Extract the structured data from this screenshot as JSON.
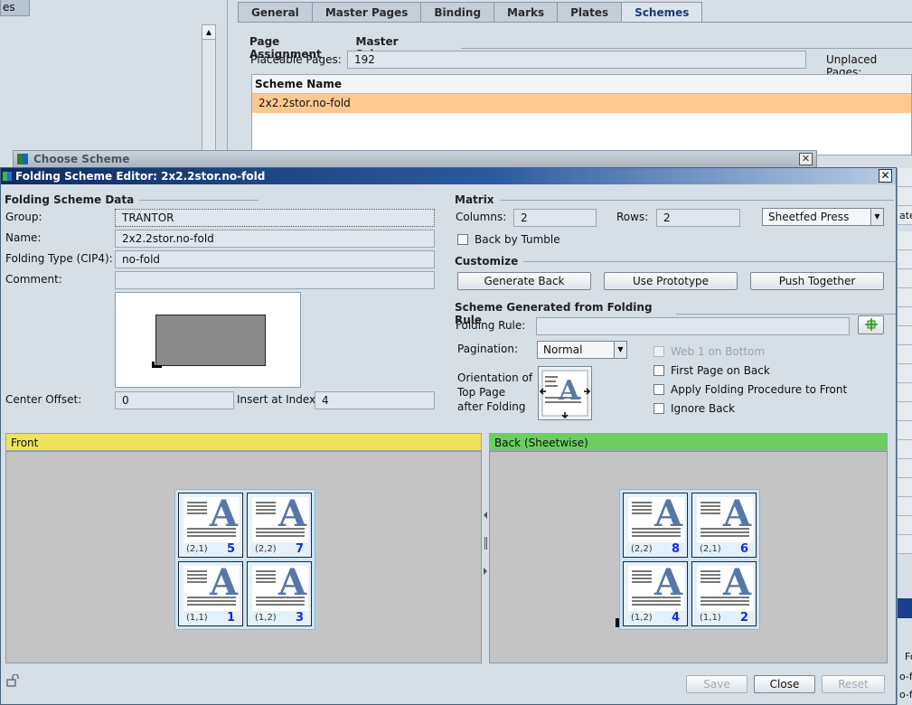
{
  "background": {
    "left_tab_label": "es",
    "tabs": [
      "General",
      "Master Pages",
      "Binding",
      "Marks",
      "Plates",
      "Schemes"
    ],
    "active_tab": "Schemes",
    "section_titles": [
      "Page Assignment",
      "Master Schemes"
    ],
    "placeable_label": "Placeable Pages:",
    "placeable_value": "192",
    "unplaced_label": "Unplaced Pages:",
    "list_header": "Scheme Name",
    "list_rows": [
      "2x2.2stor.no-fold"
    ],
    "choose_scheme_title": "Choose Scheme",
    "right_strip_texts": [
      "ate",
      "Fo",
      "o-fo",
      "o-fo"
    ]
  },
  "dialog": {
    "title": "Folding Scheme Editor: 2x2.2stor.no-fold",
    "data_section": {
      "title": "Folding Scheme Data",
      "group_label": "Group:",
      "group_value": "TRANTOR",
      "name_label": "Name:",
      "name_value": "2x2.2stor.no-fold",
      "folding_type_label": "Folding Type (CIP4):",
      "folding_type_value": "no-fold",
      "comment_label": "Comment:",
      "comment_value": "",
      "center_offset_label": "Center Offset:",
      "center_offset_value": "0",
      "insert_index_label": "Insert at Index",
      "insert_index_value": "4"
    },
    "matrix": {
      "title": "Matrix",
      "columns_label": "Columns:",
      "columns_value": "2",
      "rows_label": "Rows:",
      "rows_value": "2",
      "press_type": "Sheetfed Press",
      "back_by_tumble_label": "Back by Tumble",
      "back_by_tumble_checked": false
    },
    "customize": {
      "title": "Customize",
      "generate_back": "Generate Back",
      "use_prototype": "Use Prototype",
      "push_together": "Push Together"
    },
    "rule_section": {
      "title": "Scheme Generated from Folding Rule",
      "folding_rule_label": "Folding Rule:",
      "folding_rule_value": "",
      "pagination_label": "Pagination:",
      "pagination_value": "Normal",
      "orientation_label_1": "Orientation of",
      "orientation_label_2": "Top Page",
      "orientation_label_3": "after Folding",
      "web1_bottom": "Web 1 on Bottom",
      "first_page_back": "First Page on Back",
      "apply_folding": "Apply Folding Procedure to Front",
      "ignore_back": "Ignore Back"
    },
    "front_panel": {
      "title": "Front",
      "color": "#f0e25a",
      "pages": [
        {
          "coord": "(2,1)",
          "num": "5"
        },
        {
          "coord": "(2,2)",
          "num": "7"
        },
        {
          "coord": "(1,1)",
          "num": "1"
        },
        {
          "coord": "(1,2)",
          "num": "3"
        }
      ]
    },
    "back_panel": {
      "title": "Back (Sheetwise)",
      "color": "#6bcf5f",
      "pages": [
        {
          "coord": "(2,2)",
          "num": "8"
        },
        {
          "coord": "(2,1)",
          "num": "6"
        },
        {
          "coord": "(1,2)",
          "num": "4"
        },
        {
          "coord": "(1,1)",
          "num": "2"
        }
      ]
    },
    "buttons": {
      "save": "Save",
      "close": "Close",
      "reset": "Reset"
    }
  }
}
